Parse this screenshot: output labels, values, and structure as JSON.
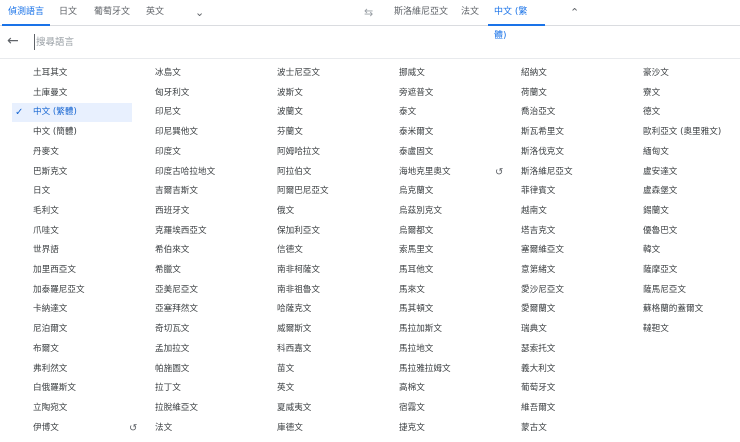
{
  "source_tabs": [
    "偵測語言",
    "日文",
    "葡萄牙文",
    "英文"
  ],
  "target_tabs": [
    "斯洛維尼亞文",
    "法文",
    "中文 (繁體)"
  ],
  "search": {
    "placeholder": "搜尋語言",
    "value": ""
  },
  "selected": "中文 (繁體)",
  "recent": [
    "法文",
    "斯洛維尼亞文"
  ],
  "columns": [
    [
      "土耳其文",
      "土庫曼文",
      "中文 (繁體)",
      "中文 (簡體)",
      "丹麥文",
      "巴斯克文",
      "日文",
      "毛利文",
      "爪哇文",
      "世界語",
      "加里西亞文",
      "加泰羅尼亞文",
      "卡納達文",
      "尼泊爾文",
      "布爾文",
      "弗利然文",
      "白俄羅斯文",
      "立陶宛文",
      "伊博文"
    ],
    [
      "冰島文",
      "匈牙利文",
      "印尼文",
      "印尼巽他文",
      "印度文",
      "印度古哈拉地文",
      "吉爾吉斯文",
      "西班牙文",
      "克羅埃西亞文",
      "希伯來文",
      "希臘文",
      "亞美尼亞文",
      "亞塞拜然文",
      "奇切瓦文",
      "孟加拉文",
      "帕施圖文",
      "拉丁文",
      "拉脫維亞文",
      "法文"
    ],
    [
      "波士尼亞文",
      "波斯文",
      "波蘭文",
      "芬蘭文",
      "阿姆哈拉文",
      "阿拉伯文",
      "阿爾巴尼亞文",
      "俄文",
      "保加利亞文",
      "信德文",
      "南非柯薩文",
      "南非祖魯文",
      "哈薩克文",
      "威爾斯文",
      "科西嘉文",
      "苗文",
      "英文",
      "夏威夷文",
      "庫德文"
    ],
    [
      "挪威文",
      "旁遮普文",
      "泰文",
      "泰米爾文",
      "泰盧固文",
      "海地克里奧文",
      "烏克蘭文",
      "烏茲別克文",
      "烏爾都文",
      "索馬里文",
      "馬耳他文",
      "馬來文",
      "馬其頓文",
      "馬拉加斯文",
      "馬拉地文",
      "馬拉雅拉姆文",
      "高棉文",
      "宿霧文",
      "捷克文"
    ],
    [
      "紹納文",
      "荷蘭文",
      "喬治亞文",
      "斯瓦希里文",
      "斯洛伐克文",
      "斯洛維尼亞文",
      "菲律賓文",
      "越南文",
      "塔吉克文",
      "塞爾維亞文",
      "意第緒文",
      "愛沙尼亞文",
      "愛爾蘭文",
      "瑞典文",
      "瑟索托文",
      "義大利文",
      "葡萄牙文",
      "維吾爾文",
      "蒙古文"
    ],
    [
      "豪沙文",
      "寮文",
      "德文",
      "歐利亞文 (奧里雅文)",
      "緬甸文",
      "盧安達文",
      "盧森堡文",
      "錫蘭文",
      "優魯巴文",
      "韓文",
      "薩摩亞文",
      "薩馬尼亞文",
      "蘇格蘭的蓋爾文",
      "韃靼文"
    ]
  ],
  "colors": {
    "accent": "#1a73e8",
    "selected_bg": "#e8f0fe"
  }
}
